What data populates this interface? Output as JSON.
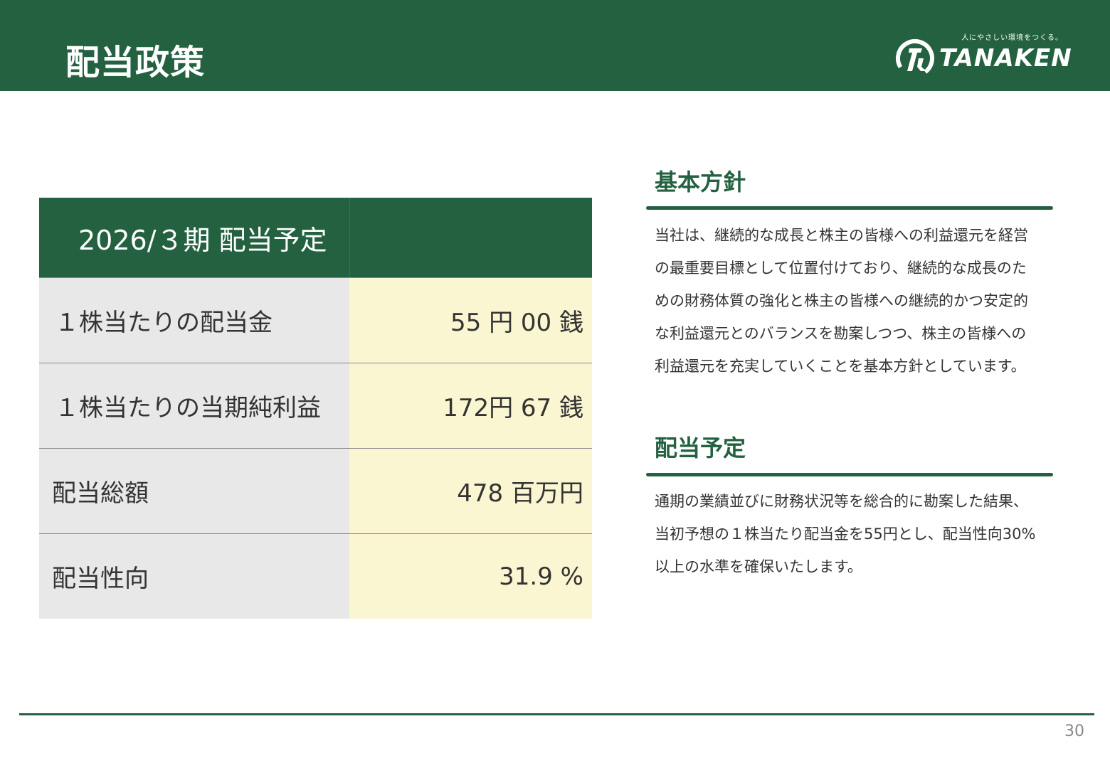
{
  "header": {
    "title": "配当政策",
    "logo_tagline": "人にやさしい環境をつくる。",
    "logo_text": "TANAKEN"
  },
  "table": {
    "header_label": "2026/３期 配当予定",
    "rows": [
      {
        "label": "１株当たりの配当金",
        "value": "55 円 00 銭"
      },
      {
        "label": "１株当たりの当期純利益",
        "value": "172円 67 銭"
      },
      {
        "label": "配当総額",
        "value": "478 百万円"
      },
      {
        "label": "配当性向",
        "value": "31.9 %"
      }
    ]
  },
  "sections": [
    {
      "title": "基本方針",
      "body": "当社は、継続的な成長と株主の皆様への利益還元を経営の最重要目標として位置付けており、継続的な成長のための財務体質の強化と株主の皆様への継続的かつ安定的な利益還元とのバランスを勘案しつつ、株主の皆様への利益還元を充実していくことを基本方針としています。"
    },
    {
      "title": "配当予定",
      "body": "通期の業績並びに財務状況等を総合的に勘案した結果、当初予想の１株当たり配当金を55円とし、配当性向30%以上の水準を確保いたします。"
    }
  ],
  "footer": {
    "page_number": "30"
  },
  "colors": {
    "brand_green": "#236140",
    "label_bg": "#e8e8e8",
    "value_bg": "#faf6d1"
  },
  "icons": {
    "logo_mark": "tanaken-logo-icon"
  }
}
